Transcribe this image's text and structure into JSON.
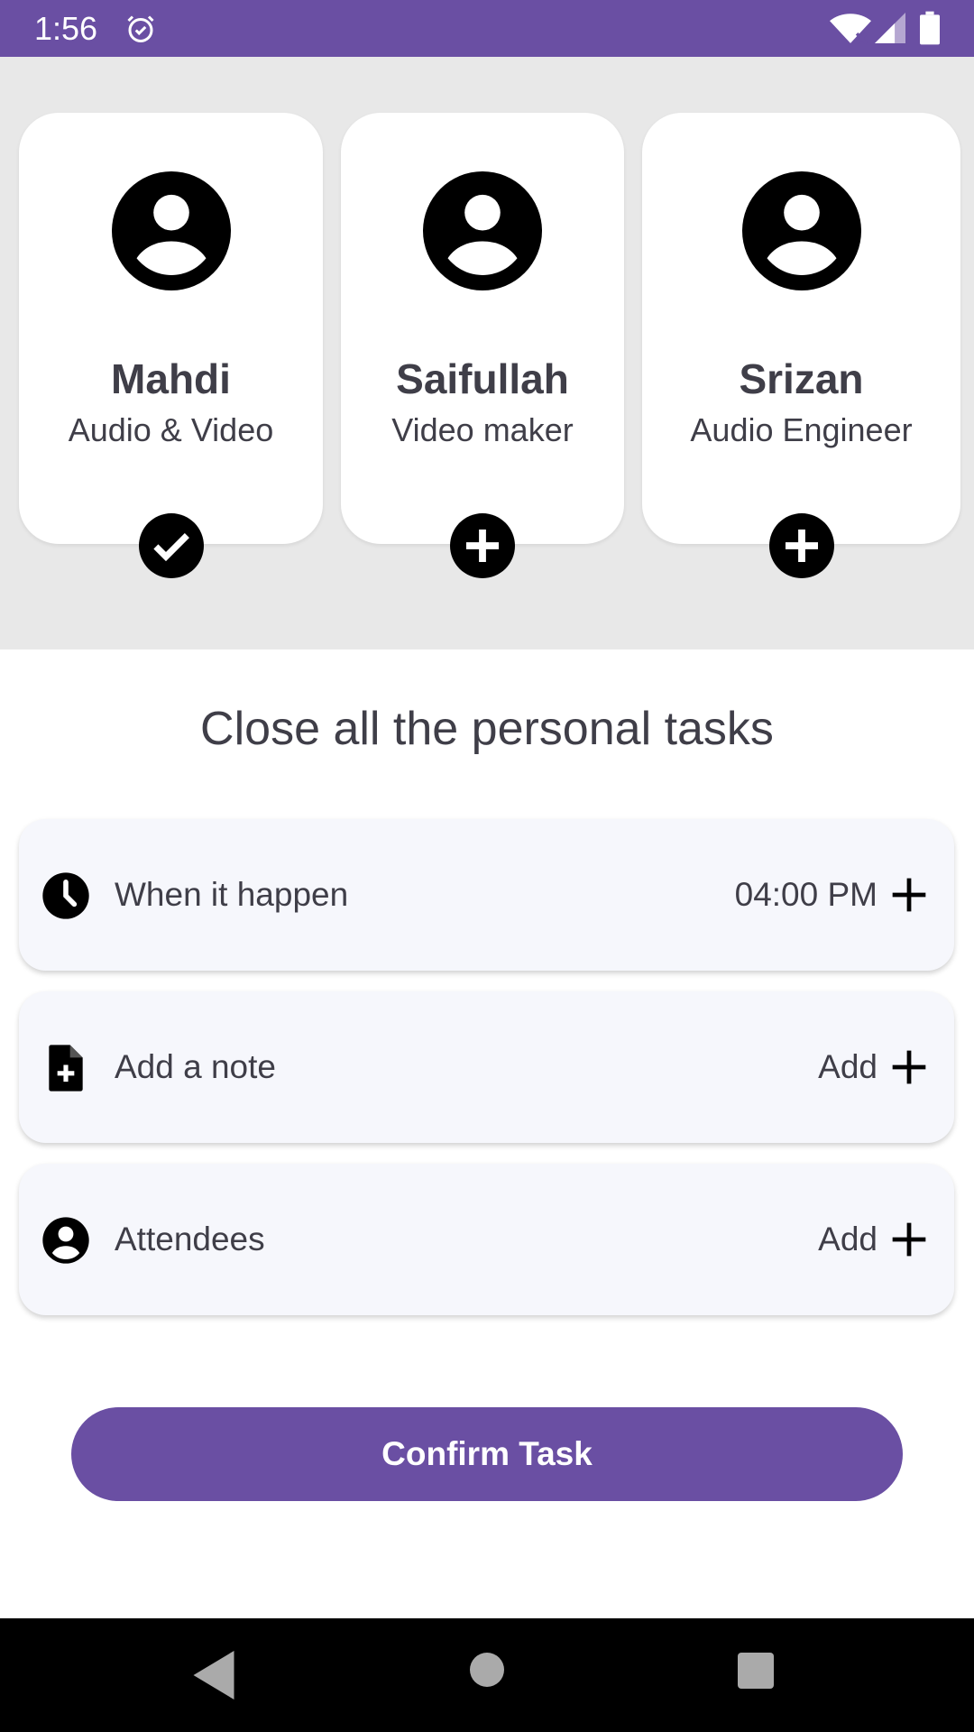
{
  "status_bar": {
    "time": "1:56",
    "icons": [
      "alarm-icon",
      "wifi-icon",
      "signal-icon",
      "battery-icon"
    ]
  },
  "members": [
    {
      "name": "Mahdi",
      "role": "Audio & Video",
      "selected": true,
      "action_icon": "check-circle-icon"
    },
    {
      "name": "Saifullah",
      "role": "Video maker",
      "selected": false,
      "action_icon": "plus-circle-icon"
    },
    {
      "name": "Srizan",
      "role": "Audio Engineer",
      "selected": false,
      "action_icon": "plus-circle-icon"
    }
  ],
  "task_title": "Close all the personal tasks",
  "rows": [
    {
      "icon": "clock-icon",
      "label": "When it happen",
      "value": "04:00 PM"
    },
    {
      "icon": "note-add-icon",
      "label": "Add a note",
      "value": "Add"
    },
    {
      "icon": "person-icon",
      "label": "Attendees",
      "value": "Add"
    }
  ],
  "confirm_label": "Confirm Task",
  "colors": {
    "primary": "#6a4fa3",
    "background_top": "#e8e8e8",
    "row_background": "#f6f7fc",
    "text": "#3f3e48"
  },
  "nav_bar": {
    "icons": [
      "back-icon",
      "home-icon",
      "recents-icon"
    ]
  }
}
